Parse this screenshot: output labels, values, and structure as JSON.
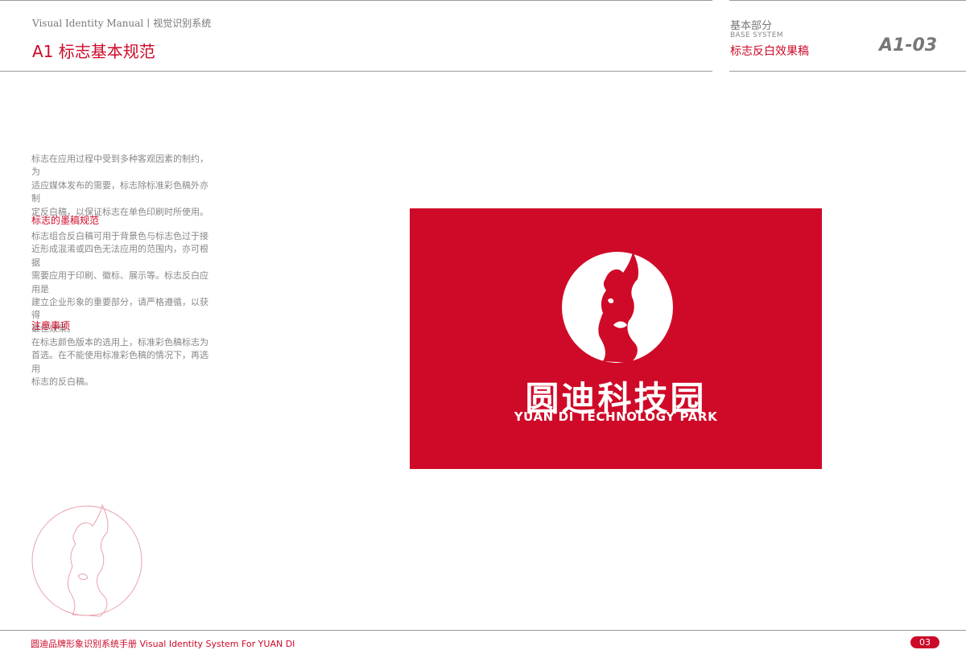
{
  "header": {
    "manual_title": "Visual Identity Manual丨视觉识别系统",
    "section_title": "A1 标志基本规范",
    "system_cn": "基本部分",
    "system_en": "BASE SYSTEM",
    "page_subject": "标志反白效果稿",
    "page_code": "A1-03"
  },
  "body": {
    "intro_lines": [
      "标志在应用过程中受到多种客观因素的制约，为",
      "适应媒体发布的需要，标志除标准彩色稿外亦制",
      "定反白稿，以保证标志在单色印刷时所使用。"
    ],
    "section1": {
      "heading": "标志的墨稿规范",
      "lines": [
        "标志组合反白稿可用于背景色与标志色过于接",
        "近形成混淆或四色无法应用的范围内，亦可根据",
        "需要应用于印刷、徽标、展示等。标志反白应用是",
        "建立企业形象的重要部分，请严格遵循，以获得",
        "最佳效果。"
      ]
    },
    "section2": {
      "heading": "注意事项",
      "lines": [
        "在标志颜色版本的选用上，标准彩色稿标志为",
        "首选。在不能使用标准彩色稿的情况下，再选用",
        "标志的反白稿。"
      ]
    }
  },
  "logo": {
    "name_cn": "圆迪科技园",
    "name_en": "YUAN DI TECHNOLOGY PARK",
    "background_color": "#cf0a28",
    "foreground_color": "#ffffff",
    "emblem_icon": "rock-in-circle-emblem"
  },
  "footer": {
    "text": "圆迪品牌形象识别系统手册  Visual Identity System For YUAN DI",
    "page_number": "03"
  },
  "colors": {
    "accent": "#cc0a28",
    "text_gray": "#888888",
    "rule_gray": "#9a9a9a"
  }
}
